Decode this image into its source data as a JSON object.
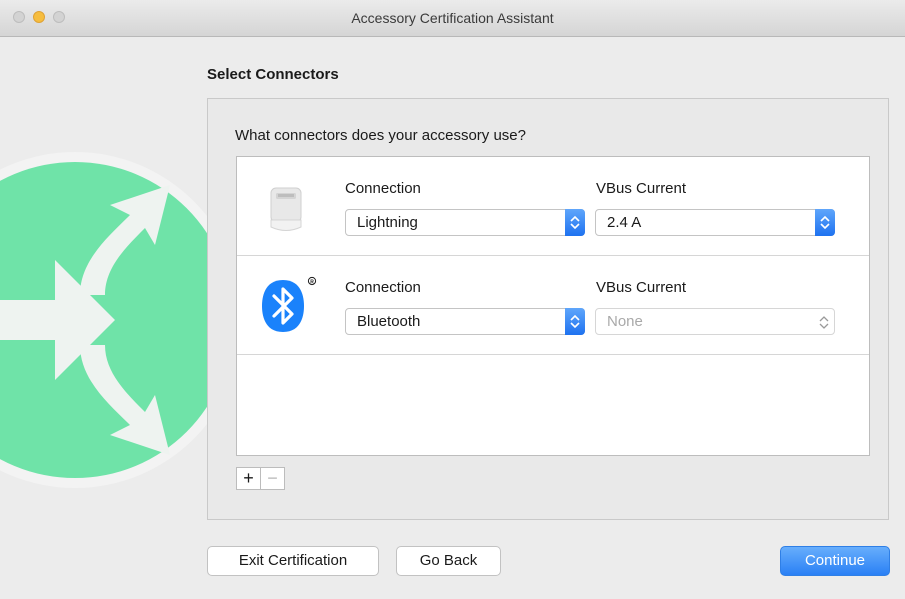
{
  "window": {
    "title": "Accessory Certification Assistant"
  },
  "page": {
    "heading": "Select Connectors",
    "question": "What connectors does your accessory use?"
  },
  "connectors": [
    {
      "icon": "lightning-connector-icon",
      "connection_label": "Connection",
      "connection_value": "Lightning",
      "vbus_label": "VBus Current",
      "vbus_value": "2.4 A",
      "vbus_enabled": true
    },
    {
      "icon": "bluetooth-icon",
      "connection_label": "Connection",
      "connection_value": "Bluetooth",
      "vbus_label": "VBus Current",
      "vbus_value": "None",
      "vbus_enabled": false
    }
  ],
  "list_controls": {
    "add_label": "+",
    "remove_label": "−"
  },
  "buttons": {
    "exit": "Exit Certification",
    "back": "Go Back",
    "continue": "Continue"
  },
  "colors": {
    "accent": "#2a80f5",
    "badge_green": "#6fe3a8",
    "bluetooth_blue": "#1a82fb"
  }
}
